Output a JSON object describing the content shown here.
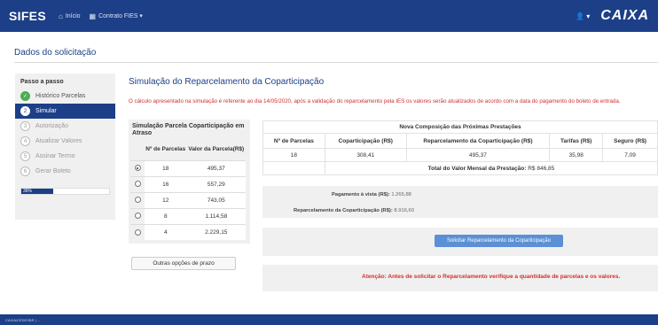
{
  "header": {
    "brand": "SIFES",
    "nav": [
      {
        "icon": "home-icon",
        "glyph": "⌂",
        "label": "Início"
      },
      {
        "icon": "grid-icon",
        "glyph": "▦",
        "label": "Contrato FIES ▾"
      }
    ],
    "user_menu": "👤 ▾",
    "logo": "CAIXA"
  },
  "section_title": "Dados do solicitação",
  "sidebar": {
    "title": "Passo a passo",
    "steps": [
      {
        "num": "✓",
        "label": "Histórico Parcelas",
        "state": "done"
      },
      {
        "num": "2",
        "label": "Simular",
        "state": "active"
      },
      {
        "num": "3",
        "label": "Autorização",
        "state": "pending"
      },
      {
        "num": "4",
        "label": "Atualizar Valores",
        "state": "pending"
      },
      {
        "num": "5",
        "label": "Assinar Termo",
        "state": "pending"
      },
      {
        "num": "6",
        "label": "Gerar Boleto",
        "state": "pending"
      }
    ],
    "progress_label": "36%",
    "progress_value": 0.36
  },
  "main": {
    "title": "Simulação do Reparcelamento da Coparticipação",
    "notice": "O cálculo apresentado na simulação é referente ao dia 14/05/2020, após a validação do reparcelamento pela IES os valores serão atualizados de acordo com a data do pagamento do boleto de entrada."
  },
  "simulation": {
    "title": "Simulação Parcela Coparticipação em Atraso",
    "col_parcelas": "Nº de Parcelas",
    "col_valor": "Valor da Parcela(R$)",
    "rows": [
      {
        "parcelas": "18",
        "valor": "495,37",
        "selected": true
      },
      {
        "parcelas": "16",
        "valor": "557,29",
        "selected": false
      },
      {
        "parcelas": "12",
        "valor": "743,05",
        "selected": false
      },
      {
        "parcelas": "8",
        "valor": "1.114,58",
        "selected": false
      },
      {
        "parcelas": "4",
        "valor": "2.229,15",
        "selected": false
      }
    ],
    "other_options_label": "Outras opções de prazo"
  },
  "composition": {
    "title": "Nova Composição das Próximas Prestações",
    "columns": [
      "Nº de Parcelas",
      "Coparticipação (R$)",
      "Reparcelamento da Coparticipação (R$)",
      "Tarifas (R$)",
      "Seguro (R$)"
    ],
    "row": [
      "18",
      "308,41",
      "495,37",
      "35,98",
      "7,09"
    ],
    "total_label": "Total do Valor Mensal da Prestação:",
    "total_value": "R$ 846,85"
  },
  "info": {
    "pagamento_label": "Pagamento à vista (R$):",
    "pagamento_value": "1.265,88",
    "reparcelamento_label": "Reparcelamento da Coparticipação (R$):",
    "reparcelamento_value": "8.916,60"
  },
  "request_button": "Solicitar Reparcelamento da Coparticipação",
  "warning": "Atenção: Antes de solicitar o Reparcelamento verifique a quantidade de parcelas e os valores.",
  "footer": "CAIXA/CEDESBR | ..."
}
